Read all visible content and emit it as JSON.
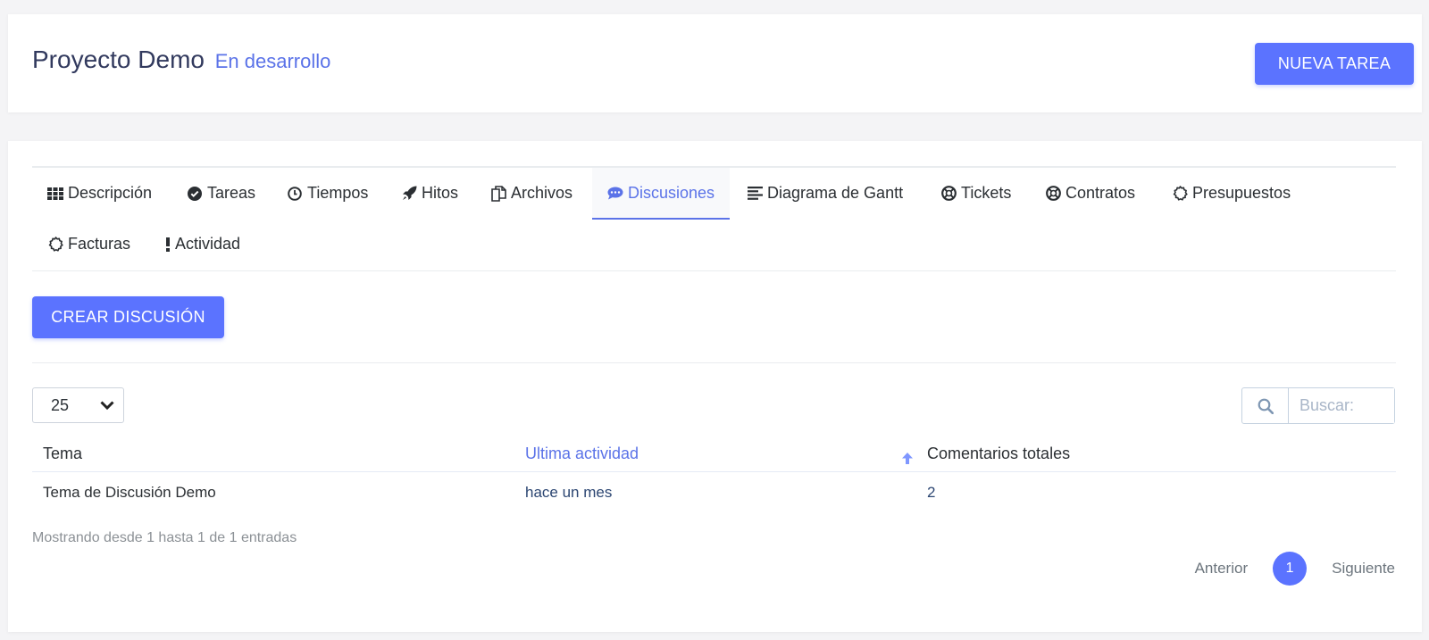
{
  "header": {
    "title": "Proyecto Demo",
    "status": "En desarrollo",
    "new_task_label": "NUEVA TAREA"
  },
  "tabs": [
    {
      "label": "Descripción",
      "icon": "grid-icon"
    },
    {
      "label": "Tareas",
      "icon": "check-circle-icon"
    },
    {
      "label": "Tiempos",
      "icon": "clock-icon"
    },
    {
      "label": "Hitos",
      "icon": "rocket-icon"
    },
    {
      "label": "Archivos",
      "icon": "files-icon"
    },
    {
      "label": "Discusiones",
      "icon": "chat-icon",
      "active": true
    },
    {
      "label": "Diagrama de Gantt",
      "icon": "align-left-icon"
    },
    {
      "label": "Tickets",
      "icon": "life-ring-icon"
    },
    {
      "label": "Contratos",
      "icon": "life-ring-icon"
    },
    {
      "label": "Presupuestos",
      "icon": "gear-icon"
    },
    {
      "label": "Facturas",
      "icon": "gear-icon"
    },
    {
      "label": "Actividad",
      "icon": "exclamation-icon"
    }
  ],
  "actions": {
    "create_discussion_label": "CREAR DISCUSIÓN"
  },
  "table_controls": {
    "page_length": "25",
    "search_placeholder": "Buscar:"
  },
  "table": {
    "columns": [
      "Tema",
      "Ultima actividad",
      "Comentarios totales"
    ],
    "sorted_column": "Ultima actividad",
    "rows": [
      [
        "Tema de Discusión Demo",
        "hace un mes",
        "2"
      ]
    ]
  },
  "footer": {
    "info": "Mostrando desde 1 hasta 1 de 1 entradas",
    "prev_label": "Anterior",
    "current_page": "1",
    "next_label": "Siguiente"
  },
  "colors": {
    "accent": "#5b73ff",
    "accent_text": "#5b73e8",
    "title": "#323a5e"
  }
}
